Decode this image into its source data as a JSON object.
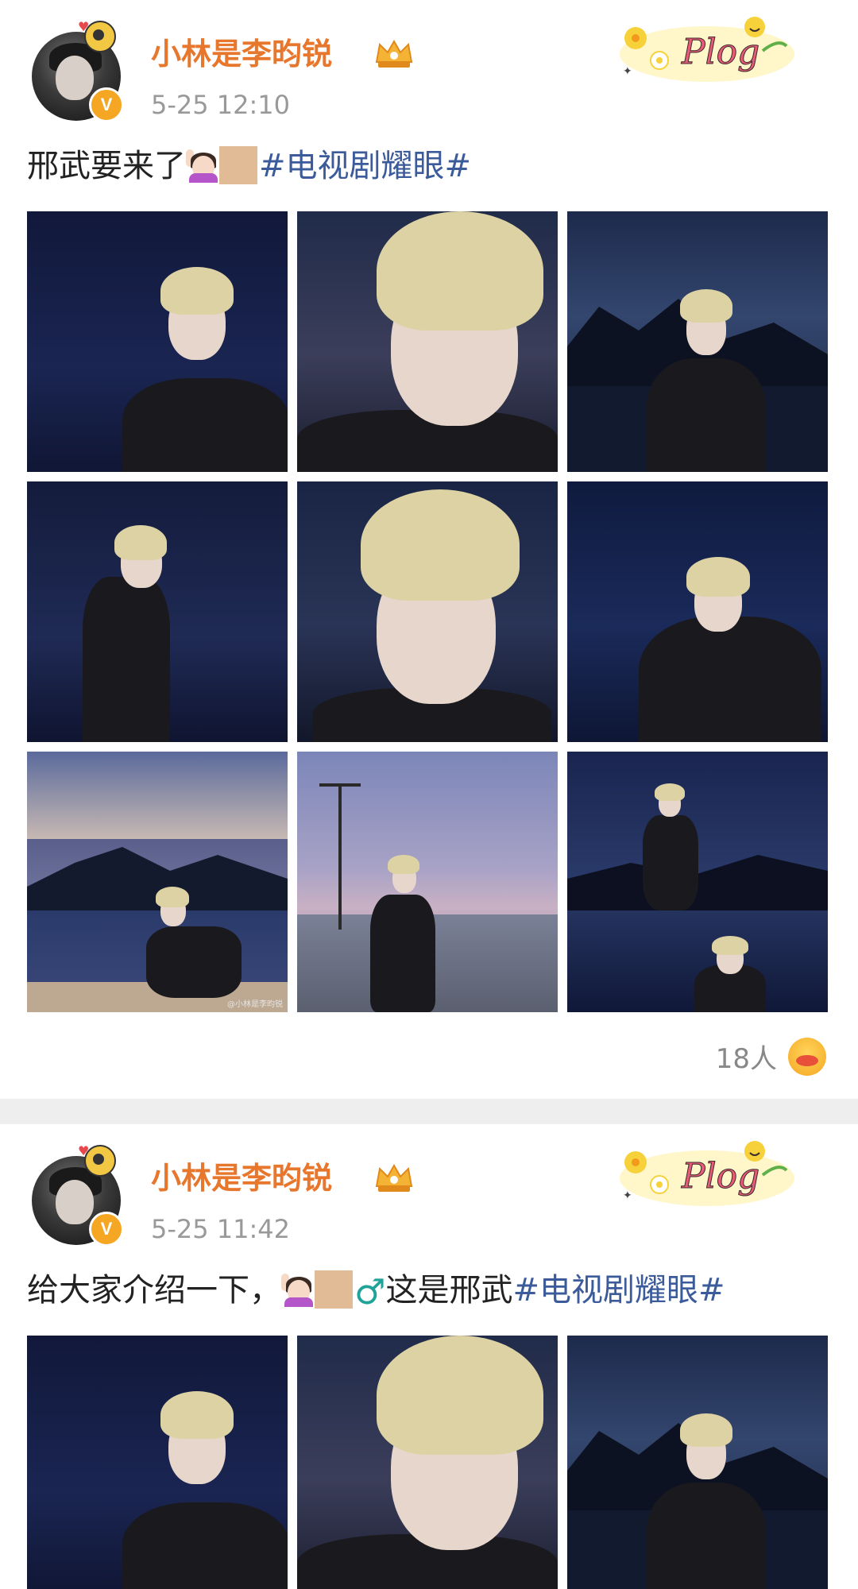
{
  "colors": {
    "username": "#e8772e",
    "timestamp": "#999999",
    "hashtag": "#3b5b9a",
    "text": "#222222",
    "verified_badge": "#f5a623",
    "divider": "#eeeeee"
  },
  "posts": [
    {
      "username": "小林是李昀锐",
      "timestamp": "5-25 12:10",
      "decoration": "Plog",
      "text_plain": "邢武要来了",
      "hashtag": "#电视剧耀眼#",
      "icons": [
        "woman-raising-hand-emoji",
        "skin-tone-modifier"
      ],
      "reaction_count": "18人",
      "watermark": "@小林是李昀锐"
    },
    {
      "username": "小林是李昀锐",
      "timestamp": "5-25 11:42",
      "decoration": "Plog",
      "text_plain": "给大家介绍一下，",
      "text_suffix": "这是邢武",
      "hashtag": "#电视剧耀眼#",
      "icons": [
        "woman-raising-hand-emoji",
        "skin-tone-modifier",
        "male-sign"
      ]
    }
  ]
}
